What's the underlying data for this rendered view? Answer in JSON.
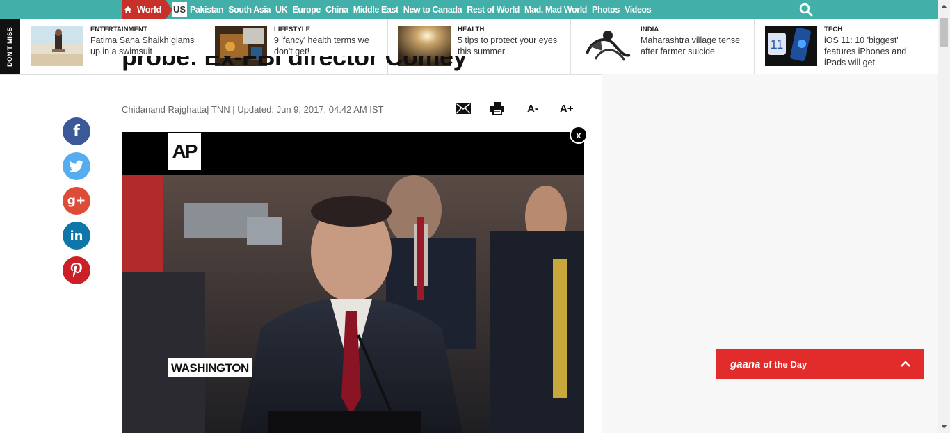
{
  "nav": {
    "home_icon": "home-icon",
    "active_section": "World",
    "active_subsection": "US",
    "links": [
      "Pakistan",
      "South Asia",
      "UK",
      "Europe",
      "China",
      "Middle East",
      "New to Canada",
      "Rest of World",
      "Mad, Mad World",
      "Photos",
      "Videos"
    ],
    "search_icon": "search-icon",
    "bg_color": "#42b0a9",
    "accent_color": "#c8302a"
  },
  "dont_miss": {
    "label": "DON'T MISS",
    "items": [
      {
        "category": "ENTERTAINMENT",
        "title": "Fatima Sana Shaikh glams up in a swimsuit"
      },
      {
        "category": "LIFESTYLE",
        "title": "9 'fancy' health terms we don't get!"
      },
      {
        "category": "HEALTH",
        "title": "5 tips to protect your eyes this summer"
      },
      {
        "category": "INDIA",
        "title": "Maharashtra village tense after farmer suicide"
      },
      {
        "category": "TECH",
        "title": "iOS 11: 10 'biggest' features iPhones and iPads will get"
      }
    ]
  },
  "article": {
    "headline_fragment": "probe: Ex-FBI director Comey",
    "author": "Chidanand Rajghatta",
    "byline_rest": "| TNN | Updated: Jun 9, 2017, 04.42 AM IST",
    "tools": {
      "email_icon": "email-icon",
      "print_icon": "print-icon",
      "font_decrease": "A-",
      "font_increase": "A+"
    }
  },
  "social": [
    {
      "name": "facebook",
      "glyph": "f",
      "color": "#3b5998"
    },
    {
      "name": "twitter",
      "glyph": "t",
      "color": "#55acee"
    },
    {
      "name": "google-plus",
      "glyph": "g+",
      "color": "#dd4b39"
    },
    {
      "name": "linkedin",
      "glyph": "in",
      "color": "#0e76a8"
    },
    {
      "name": "pinterest",
      "glyph": "p",
      "color": "#cb2027"
    }
  ],
  "video": {
    "close_label": "x",
    "logo_text": "AP",
    "location_label": "WASHINGTON"
  },
  "gaana": {
    "brand": "gaana",
    "label": "of the Day",
    "toggle_icon": "chevron-up-icon",
    "color": "#e22b2b"
  }
}
